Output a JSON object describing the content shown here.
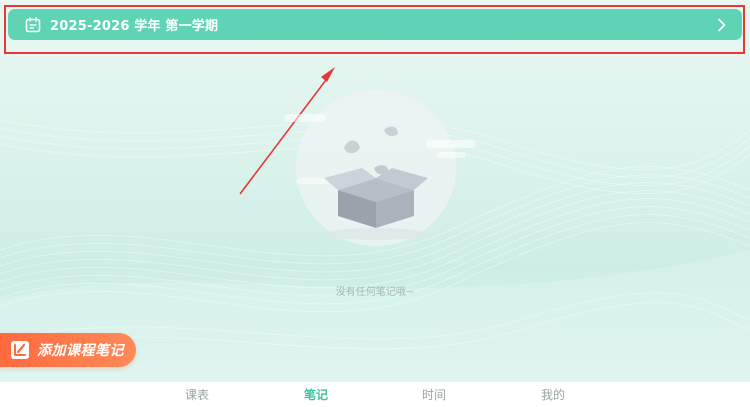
{
  "semester": {
    "label": "2025-2026 学年 第一学期",
    "icon": "calendar-icon",
    "chevron": "chevron-right-icon",
    "color": "#5fd4b4"
  },
  "annotation": {
    "highlight_color": "#e53935"
  },
  "empty_state": {
    "message": "没有任何笔记哦~",
    "illustration": "empty-box-icon"
  },
  "add_note": {
    "label": "添加课程笔记",
    "icon": "note-icon",
    "color": "#ff6a3d"
  },
  "tabs": [
    {
      "label": "课表",
      "active": false
    },
    {
      "label": "笔记",
      "active": true
    },
    {
      "label": "时间",
      "active": false
    },
    {
      "label": "我的",
      "active": false
    }
  ],
  "colors": {
    "accent": "#3ac59b",
    "tab_inactive": "#9aa5a2"
  }
}
